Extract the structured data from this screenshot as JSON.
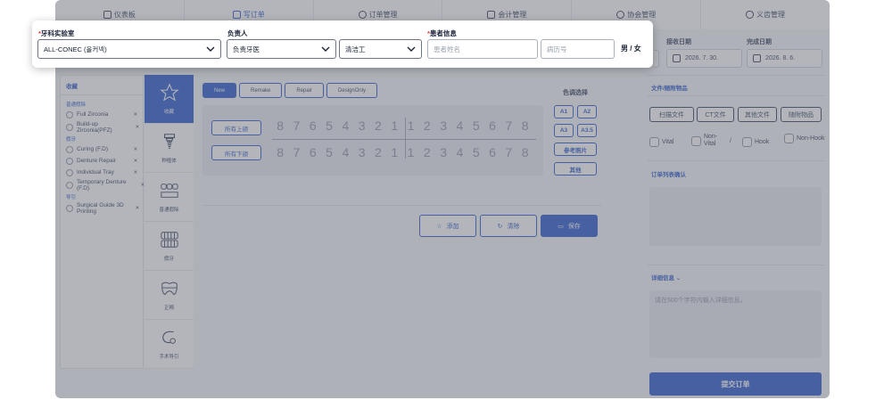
{
  "nav": {
    "tabs": [
      {
        "label": "仪表板",
        "icon": "grid-icon"
      },
      {
        "label": "写订单",
        "icon": "document-icon",
        "active": true
      },
      {
        "label": "订单管理",
        "icon": "settings-icon"
      },
      {
        "label": "会计管理",
        "icon": "wallet-icon"
      },
      {
        "label": "协会管理",
        "icon": "user-icon"
      },
      {
        "label": "义齿管理",
        "icon": "denture-icon"
      }
    ]
  },
  "popup": {
    "lab_label": "牙科实验室",
    "lab_value": "ALL-CONEC (올커넥)",
    "person_label": "负责人",
    "doctor_value": "负责牙医",
    "technician_value": "清洁工",
    "patient_label": "患者信息",
    "patient_name_placeholder": "患者姓名",
    "record_placeholder": "病历号",
    "gender_male": "男",
    "gender_sep": "/",
    "gender_female": "女"
  },
  "dates": {
    "received_label": "接收日期",
    "received_value": "2026. 7. 30.",
    "complete_label": "完成日期",
    "complete_value": "2026. 8. 6."
  },
  "files": {
    "title": "文件/随附物品",
    "buttons": [
      "扫描文件",
      "CT文件",
      "其他文件",
      "随附物品"
    ],
    "checks": [
      "Vital",
      "Non-Vital",
      "Hook",
      "Non-Hook"
    ],
    "sep": "/"
  },
  "order_list": {
    "title": "订单列表确认"
  },
  "details": {
    "title": "详细信息",
    "placeholder": "请在500个字符内输入详细信息。"
  },
  "submit_label": "提交订单",
  "favorites": {
    "title": "收藏",
    "groups": [
      {
        "name": "普通假除",
        "items": [
          "Full Zirconia",
          "Build-up Zirconia(PFZ)"
        ]
      },
      {
        "name": "假牙",
        "items": [
          "Curing (F.D)",
          "Denture Repair",
          "Individual Tray",
          "Temporary Denture (F.D)"
        ]
      },
      {
        "name": "导引",
        "items": [
          "Surgical Guide 3D Printing"
        ]
      }
    ],
    "remove_symbol": "×"
  },
  "categories": [
    {
      "label": "收藏",
      "icon": "star-icon",
      "active": true
    },
    {
      "label": "种植体",
      "icon": "implant-icon"
    },
    {
      "label": "普通假除",
      "icon": "bridge-icon"
    },
    {
      "label": "假牙",
      "icon": "denture-icon"
    },
    {
      "label": "正畸",
      "icon": "orthodontic-icon"
    },
    {
      "label": "手术导引",
      "icon": "surgical-guide-icon"
    }
  ],
  "order_types": [
    "New",
    "Remake",
    "Repair",
    "DesignOnly"
  ],
  "teeth": {
    "upper_label": "所有上颌",
    "lower_label": "所有下颌",
    "numbers": [
      "8",
      "7",
      "6",
      "5",
      "4",
      "3",
      "2",
      "1",
      "1",
      "2",
      "3",
      "4",
      "5",
      "6",
      "7",
      "8"
    ]
  },
  "shade": {
    "title": "色调选择",
    "shades": [
      "A1",
      "A2",
      "A3",
      "A3.5"
    ],
    "reference": "参考照片",
    "other": "其他"
  },
  "actions": {
    "add": "添加",
    "clear": "清除",
    "save": "保存"
  },
  "colors": {
    "accent": "#1e4ec8",
    "required": "#e03a3a"
  }
}
